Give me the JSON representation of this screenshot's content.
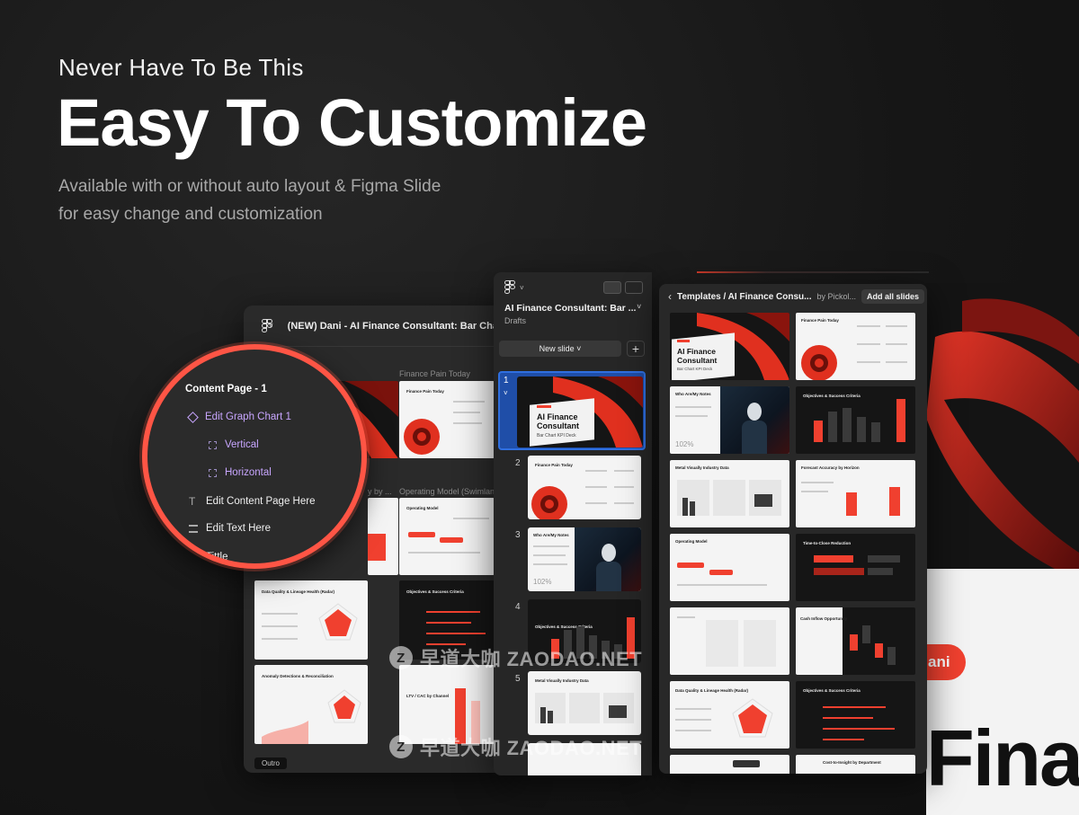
{
  "hero": {
    "subtitle": "Never Have To Be This",
    "title": "Easy To Customize",
    "desc_line1": "Available with or without auto layout  & Figma Slide",
    "desc_line2": "for easy change and customization"
  },
  "back_window": {
    "file_title": "(NEW) Dani - AI Finance Consultant: Bar Chart KP",
    "captions": [
      "Finance Pain Today",
      "Operating Model (Swimlane)",
      "y by ..."
    ],
    "slide_titles": [
      "Finance Pain Today",
      "Operating Model",
      "Data Quality & Lineage Health (Radar)",
      "Objectives & Success Criteria",
      "Anomaly Detections & Reconciliation",
      "LTV / CAC by Channel"
    ],
    "outro_label": "Outro"
  },
  "layers": {
    "header": "Content Page - 1",
    "items": [
      {
        "label": "Edit Graph Chart 1",
        "icon": "diamond-icon"
      },
      {
        "label": "Vertical",
        "icon": "frame-icon"
      },
      {
        "label": "Horizontal",
        "icon": "frame-icon"
      },
      {
        "label": "Edit Content Page Here",
        "icon": "text-icon"
      },
      {
        "label": "Edit Text Here",
        "icon": "layout-icon"
      },
      {
        "label": "Tittle",
        "icon": "text-icon"
      }
    ]
  },
  "slides_panel": {
    "file_title": "AI Finance Consultant: Bar ...",
    "location": "Drafts",
    "new_slide_label": "New slide ˅",
    "plus": "+",
    "slide_numbers": [
      "1",
      "2",
      "3",
      "4",
      "5"
    ],
    "cover_title": "AI Finance Consultant",
    "cover_sub": "Bar Chart KPI Deck",
    "thumb_titles": [
      "Finance Pain Today",
      "Who Are/My Notes",
      "Objectives & Success Criteria",
      "Metal Visually Industry Data"
    ]
  },
  "templates_panel": {
    "breadcrumb": "Templates / AI Finance Consu...",
    "author": "by Pickol...",
    "add_all_label": "Add all slides",
    "cover_title": "AI Finance Consultant",
    "cover_sub": "Bar Chart KPI Deck",
    "thumb_titles": [
      "Finance Pain Today",
      "Who Are/My Notes",
      "Objectives & Success Criteria",
      "Metal Visually Industry Data",
      "Forecast Accuracy by Horizon",
      "Operating Model",
      "Time-to-Close Reduction",
      "Cash Inflow Opportunity",
      "Data Quality & Lineage Health (Radar)",
      "Objectives & Success Criteria",
      "Cost-to-Insight by Department"
    ]
  },
  "background_slide": {
    "pill_text": "ani",
    "big_text": "Fina"
  },
  "watermark": {
    "text": "早道大咖 ZAODAO.NET",
    "logo": "Z"
  },
  "colors": {
    "accent_red": "#f0402f",
    "selection_blue": "#1f4ea8",
    "layer_purple": "#c8a6ff"
  }
}
